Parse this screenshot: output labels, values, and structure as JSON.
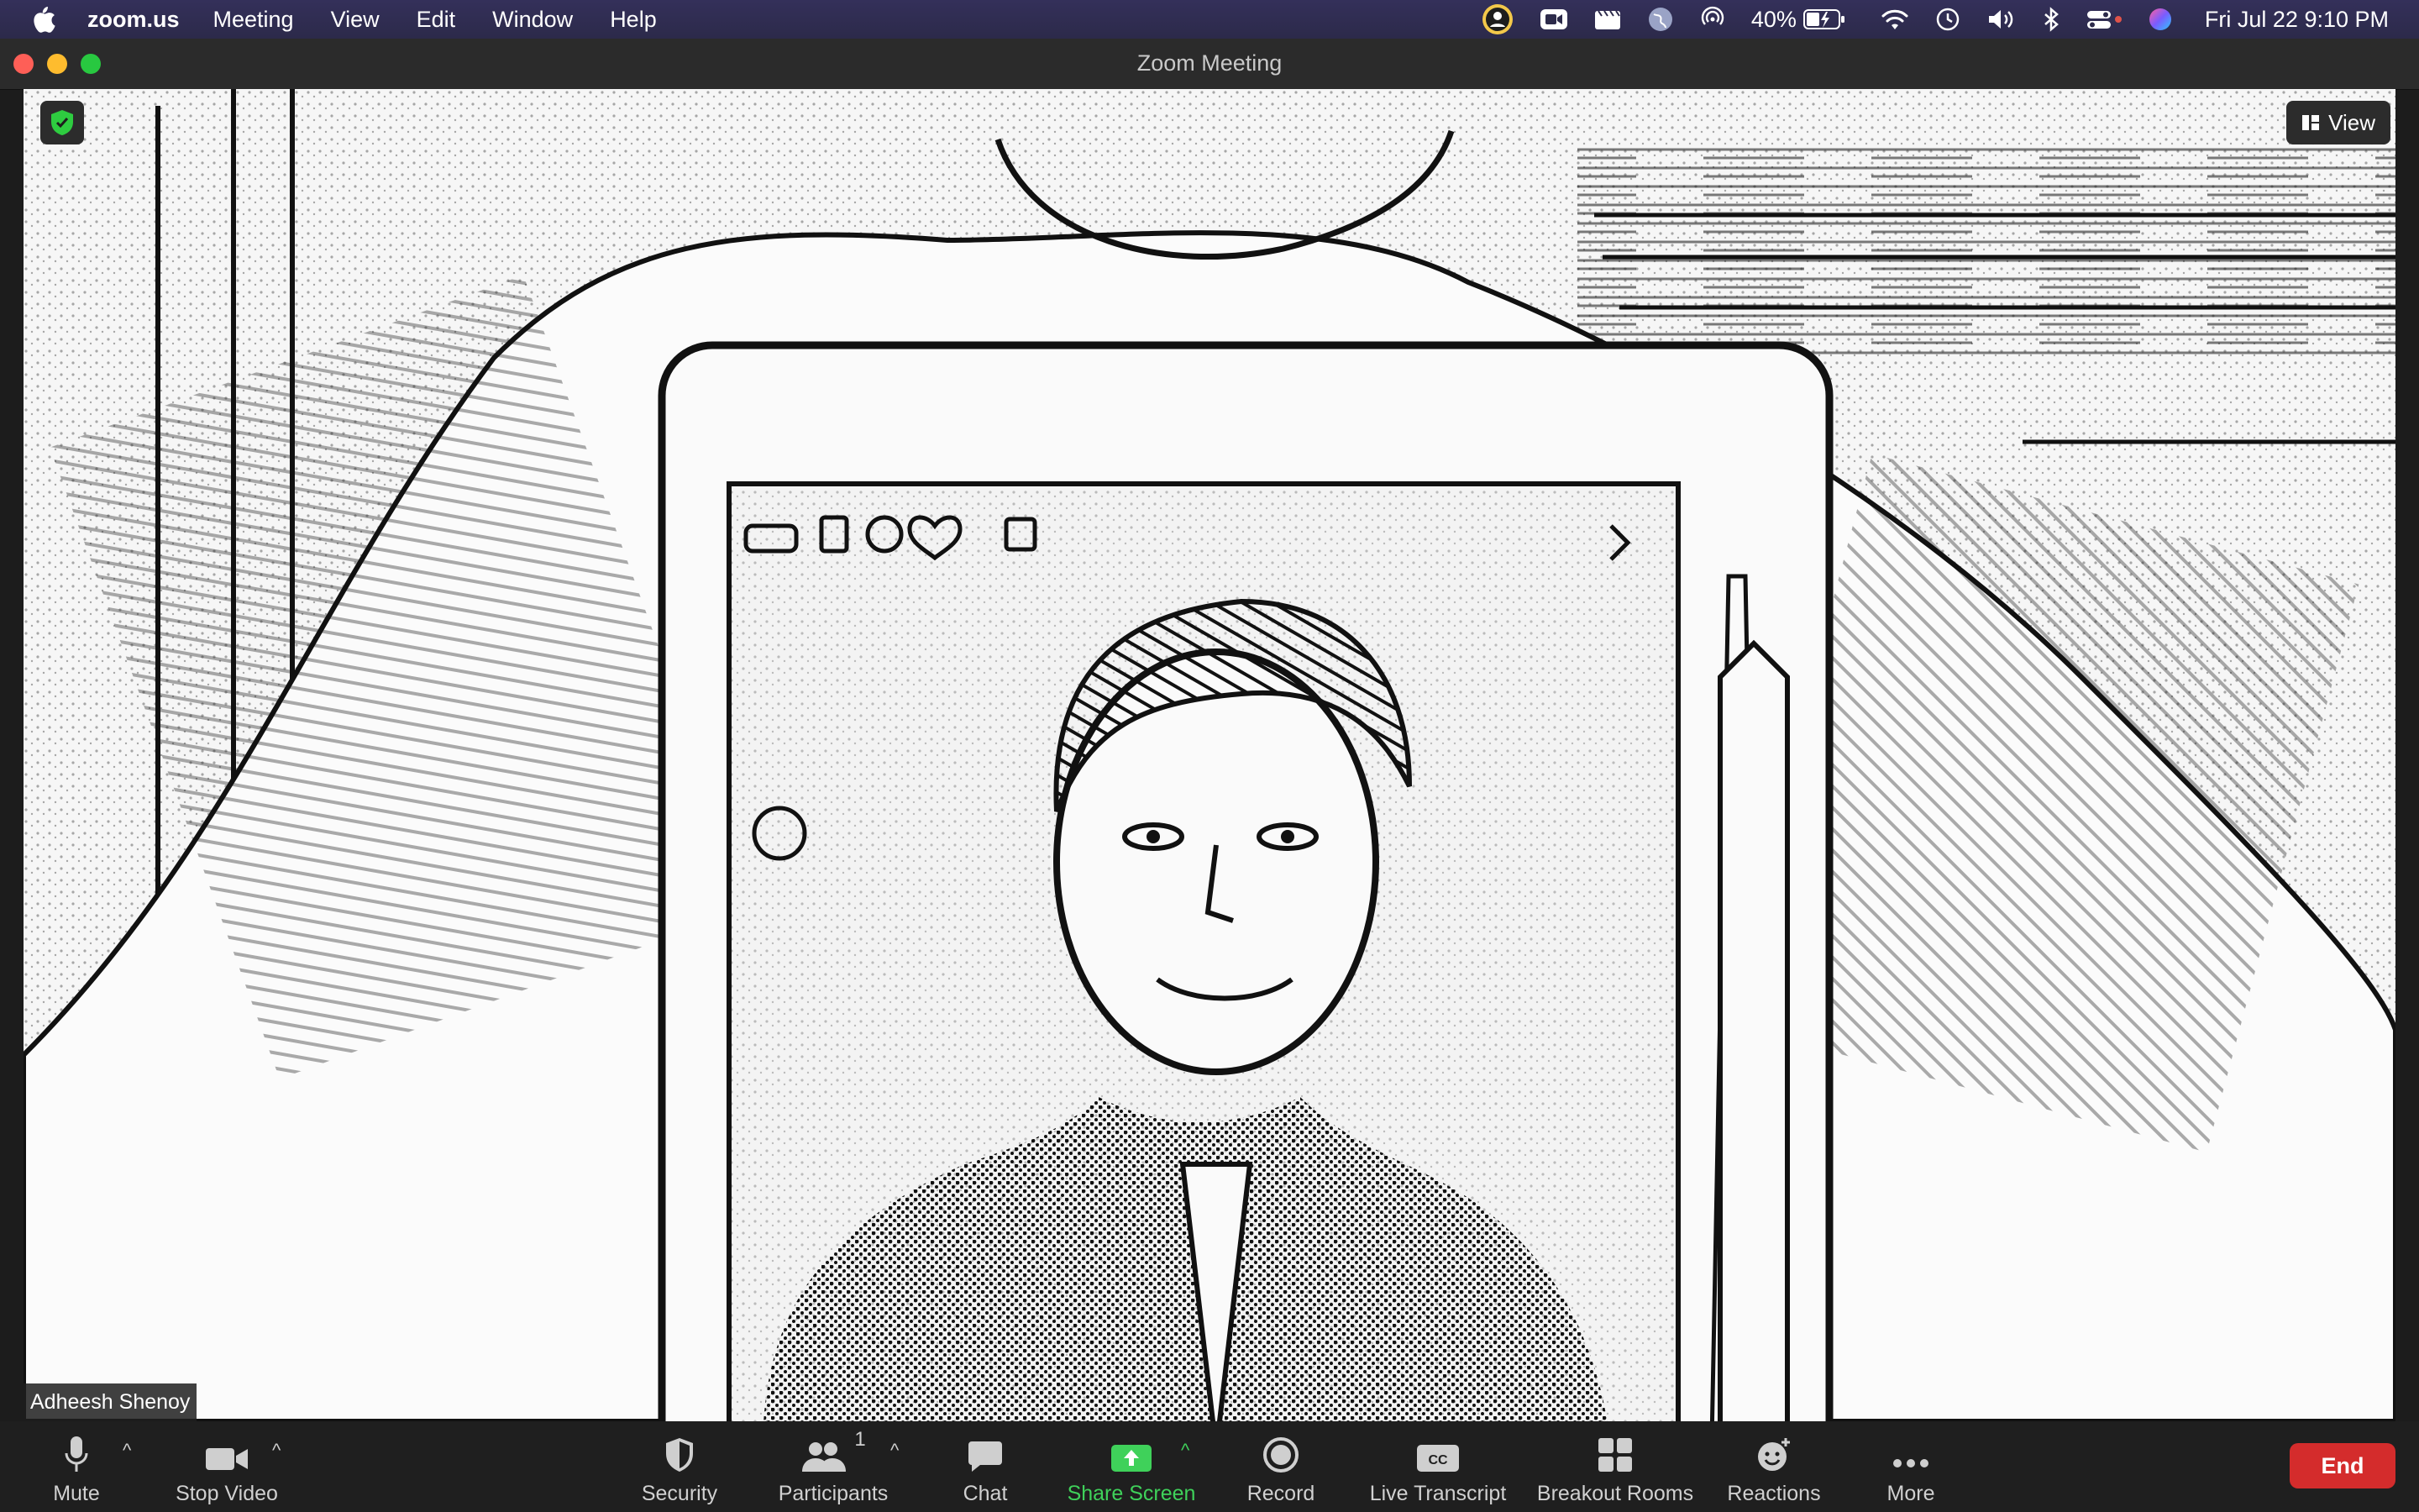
{
  "menubar": {
    "app_name": "zoom.us",
    "items": [
      "Meeting",
      "View",
      "Edit",
      "Window",
      "Help"
    ],
    "battery": "40%",
    "clock": "Fri Jul 22  9:10 PM"
  },
  "window": {
    "title": "Zoom Meeting"
  },
  "video": {
    "view_label": "View",
    "participant_name": "Adheesh Shenoy"
  },
  "toolbar": {
    "mute": "Mute",
    "stop_video": "Stop Video",
    "security": "Security",
    "participants": "Participants",
    "participants_count": "1",
    "chat": "Chat",
    "share_screen": "Share Screen",
    "record": "Record",
    "live_transcript": "Live Transcript",
    "breakout_rooms": "Breakout Rooms",
    "reactions": "Reactions",
    "more": "More",
    "end": "End"
  },
  "colors": {
    "share_green": "#3fd15a",
    "end_red": "#d42c2c",
    "menubar": "#2c2a4a",
    "security_green": "#2ecc40"
  }
}
